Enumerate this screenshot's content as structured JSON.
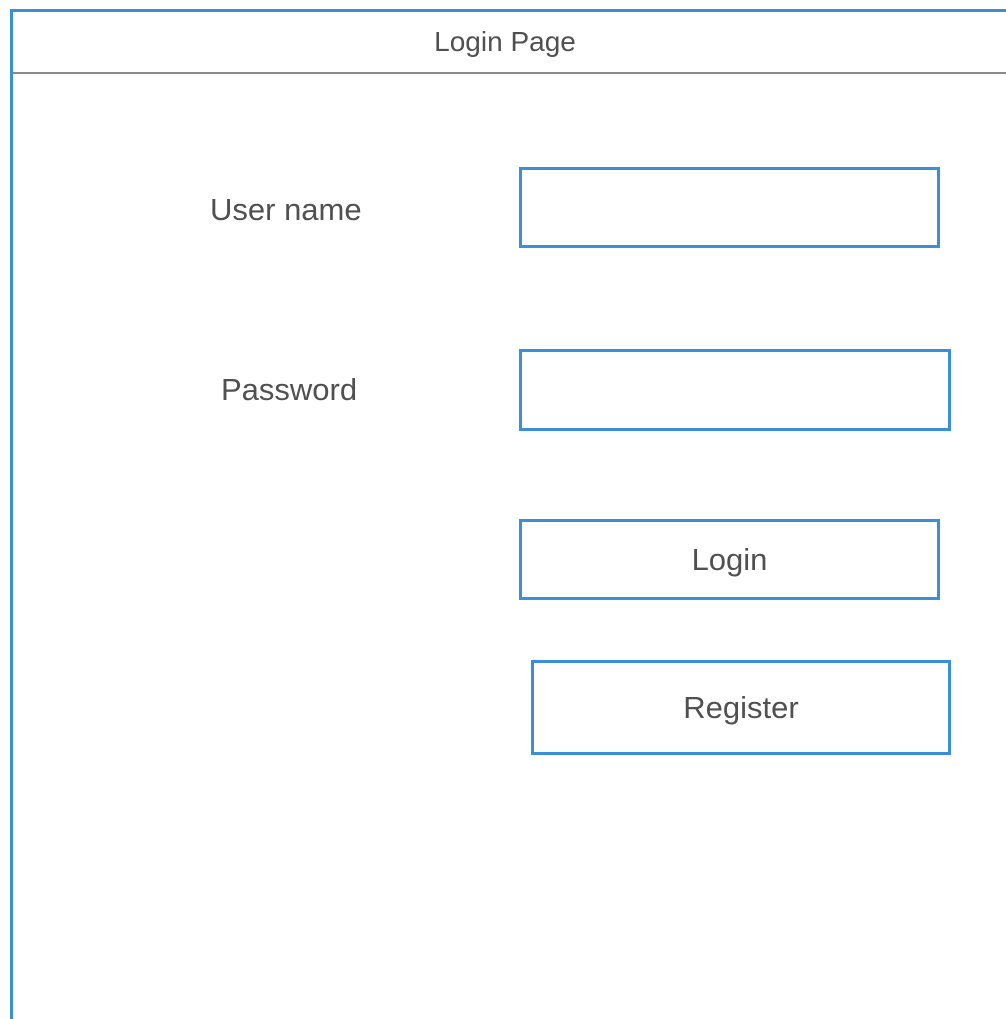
{
  "header": {
    "title": "Login Page"
  },
  "form": {
    "username_label": "User name",
    "username_value": "",
    "password_label": "Password",
    "password_value": "",
    "login_label": "Login",
    "register_label": "Register"
  },
  "colors": {
    "accent": "#3a8fd6",
    "text": "#505050",
    "divider": "#8a8a8a"
  }
}
